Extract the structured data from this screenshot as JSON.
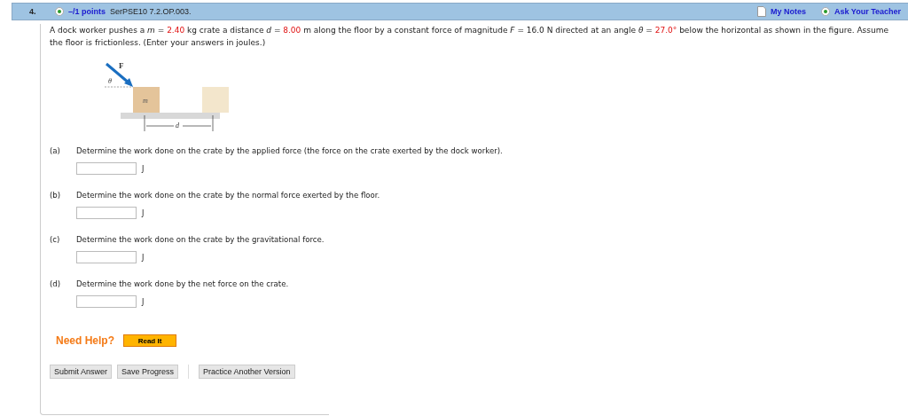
{
  "header": {
    "number": "4.",
    "points": "–/1 points",
    "code": "SerPSE10 7.2.OP.003.",
    "links": [
      "My Notes",
      "Ask Your Teacher"
    ]
  },
  "problem": [
    {
      "kind": "text",
      "t": "A dock worker pushes a "
    },
    {
      "kind": "var",
      "t": "m"
    },
    {
      "kind": "text",
      "t": " = "
    },
    {
      "kind": "value",
      "t": "2.40"
    },
    {
      "kind": "text",
      "t": " kg crate a distance "
    },
    {
      "kind": "var",
      "t": "d"
    },
    {
      "kind": "text",
      "t": " = "
    },
    {
      "kind": "value",
      "t": "8.00"
    },
    {
      "kind": "text",
      "t": " m along the floor by a constant force of magnitude "
    },
    {
      "kind": "var",
      "t": "F"
    },
    {
      "kind": "text",
      "t": " = 16.0 N directed at an angle "
    },
    {
      "kind": "var",
      "t": "θ"
    },
    {
      "kind": "text",
      "t": " = "
    },
    {
      "kind": "value",
      "t": "27.0°"
    },
    {
      "kind": "text",
      "t": " below the horizontal as shown in the figure. Assume the floor is frictionless. (Enter your answers in joules.)"
    }
  ],
  "figure": {
    "force": "F",
    "angle": "θ",
    "mass": "m",
    "distance": "d"
  },
  "parts": [
    {
      "label": "(a)",
      "question": "Determine the work done on the crate by the applied force (the force on the crate exerted by the dock worker).",
      "unit": "J"
    },
    {
      "label": "(b)",
      "question": "Determine the work done on the crate by the normal force exerted by the floor.",
      "unit": "J"
    },
    {
      "label": "(c)",
      "question": "Determine the work done on the crate by the gravitational force.",
      "unit": "J"
    },
    {
      "label": "(d)",
      "question": "Determine the work done by the net force on the crate.",
      "unit": "J"
    }
  ],
  "help": {
    "title": "Need Help?",
    "button": "Read It"
  },
  "buttons": [
    "Submit Answer",
    "Save Progress"
  ],
  "practice_button": "Practice Another Version"
}
